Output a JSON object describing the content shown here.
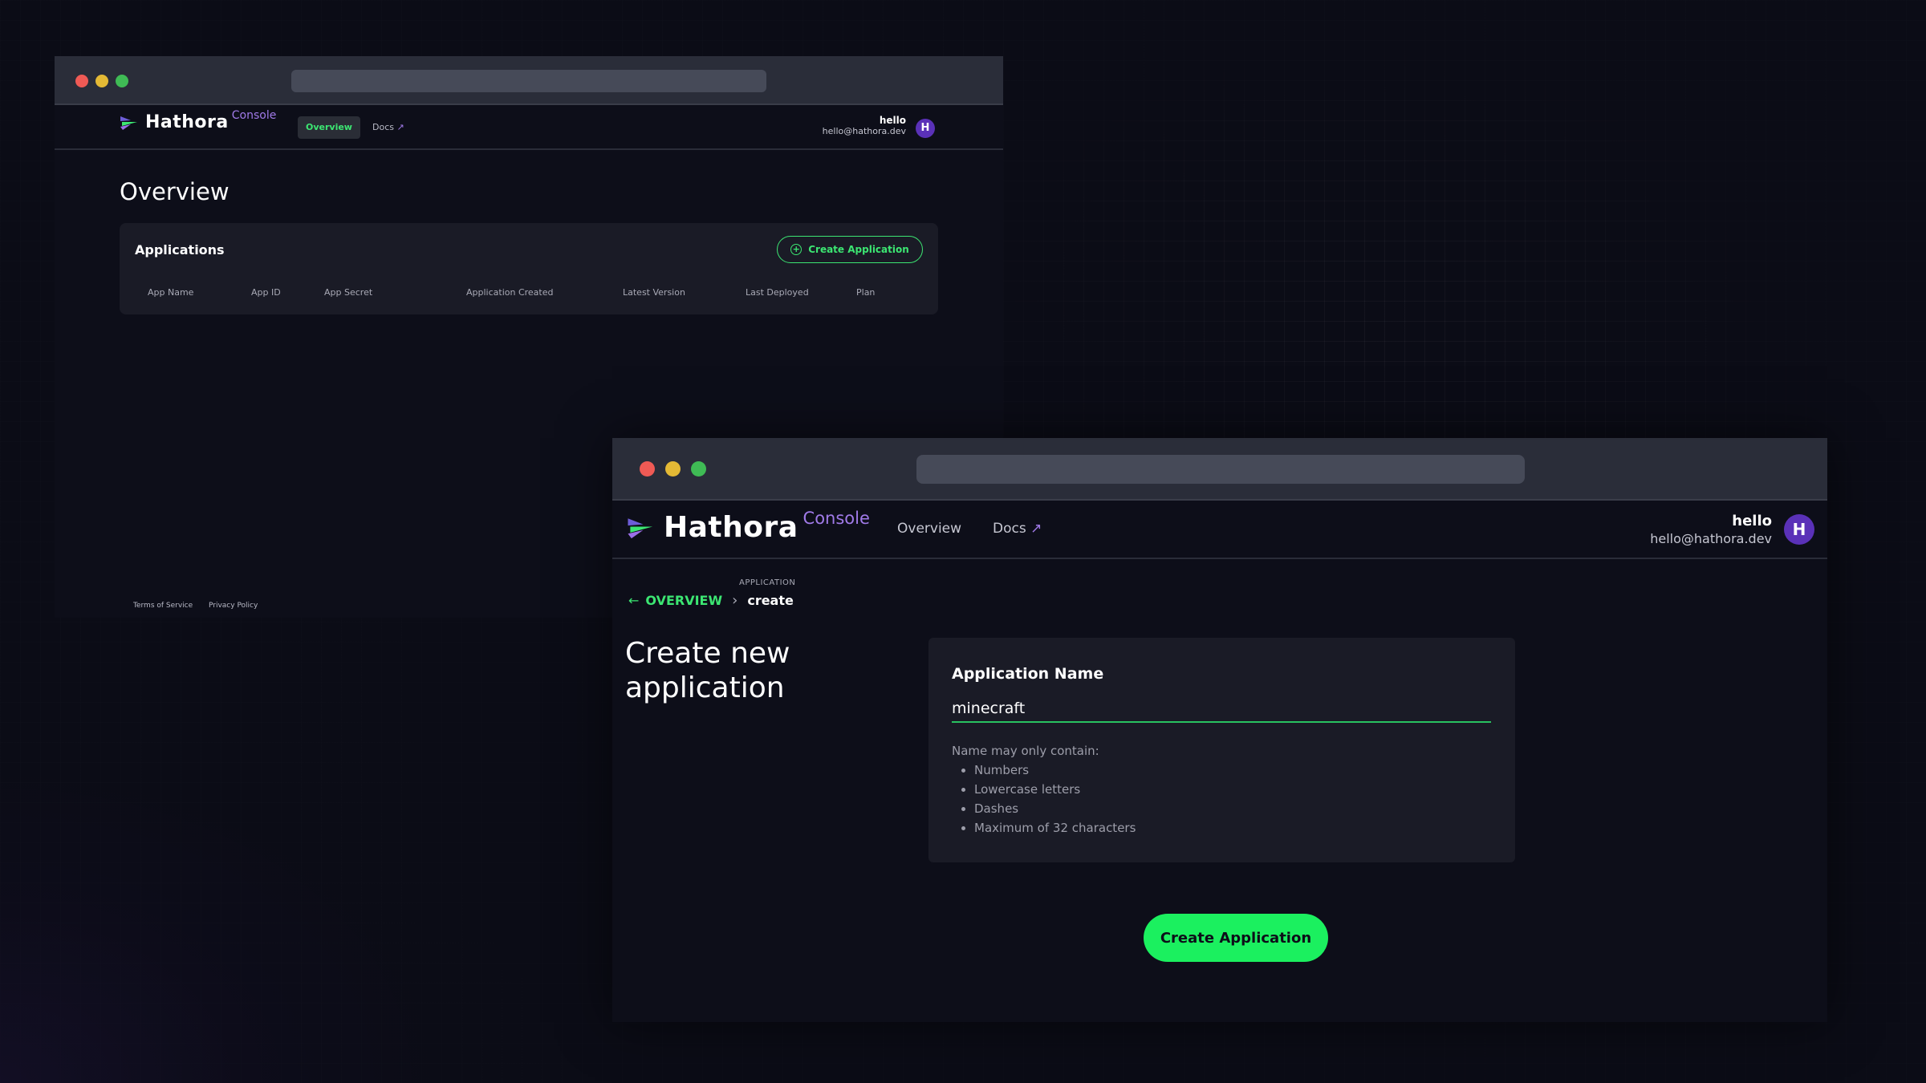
{
  "brand": {
    "name": "Hathora",
    "sub": "Console"
  },
  "nav": {
    "overview": "Overview",
    "docs": "Docs",
    "docs_arrow": "↗"
  },
  "user": {
    "name": "hello",
    "email": "hello@hathora.dev",
    "initial": "H"
  },
  "overview_page": {
    "title": "Overview",
    "applications": {
      "title": "Applications",
      "create_button": "Create Application",
      "columns": [
        "App Name",
        "App ID",
        "App Secret",
        "Application Created",
        "Latest Version",
        "Last Deployed",
        "Plan"
      ]
    },
    "footer": {
      "terms": "Terms of Service",
      "privacy": "Privacy Policy"
    }
  },
  "create_page": {
    "breadcrumb": {
      "label": "APPLICATION",
      "back": "OVERVIEW",
      "current": "create"
    },
    "heading": "Create new application",
    "field_label": "Application Name",
    "field_value": "minecraft",
    "rules_intro": "Name may only contain:",
    "rules": [
      "Numbers",
      "Lowercase letters",
      "Dashes",
      "Maximum of 32 characters"
    ],
    "submit": "Create Application"
  },
  "colors": {
    "accent_green": "#1bf05f",
    "accent_purple": "#a07ae8",
    "background": "#0b0c16",
    "card": "#1a1b26"
  }
}
